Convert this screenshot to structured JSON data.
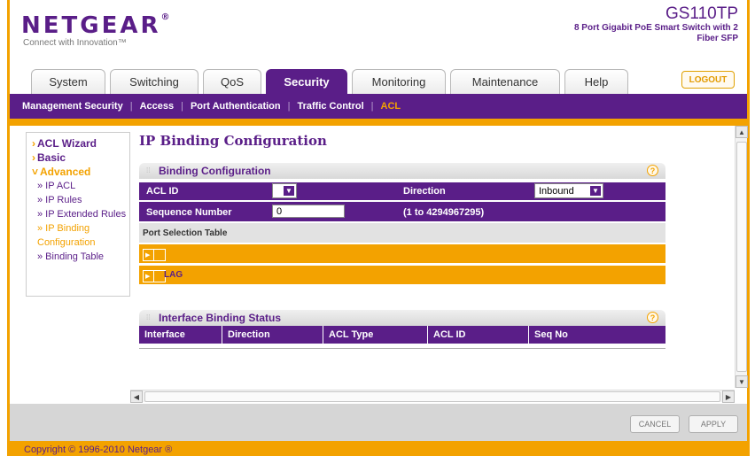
{
  "header": {
    "logo": "NETGEAR",
    "logo_mark": "®",
    "tagline": "Connect with Innovation™",
    "model_name": "GS110TP",
    "model_desc": "8 Port Gigabit PoE Smart Switch with 2 Fiber SFP"
  },
  "tabs": [
    {
      "label": "System",
      "active": false
    },
    {
      "label": "Switching",
      "active": false
    },
    {
      "label": "QoS",
      "active": false
    },
    {
      "label": "Security",
      "active": true
    },
    {
      "label": "Monitoring",
      "active": false
    },
    {
      "label": "Maintenance",
      "active": false
    },
    {
      "label": "Help",
      "active": false
    }
  ],
  "logout_label": "LOGOUT",
  "submenu": [
    {
      "label": "Management Security",
      "active": false
    },
    {
      "label": "Access",
      "active": false
    },
    {
      "label": "Port Authentication",
      "active": false
    },
    {
      "label": "Traffic Control",
      "active": false
    },
    {
      "label": "ACL",
      "active": true
    }
  ],
  "leftnav": {
    "acl_wizard": "ACL Wizard",
    "basic": "Basic",
    "advanced": "Advanced",
    "ip_acl": "» IP ACL",
    "ip_rules": "» IP Rules",
    "ip_extended_rules": "» IP Extended Rules",
    "ip_binding_configuration": "» IP Binding Configuration",
    "binding_table": "» Binding Table"
  },
  "page_title": "IP Binding Configuration",
  "binding_config": {
    "section_title": "Binding Configuration",
    "acl_id_label": "ACL ID",
    "acl_id_value": "",
    "direction_label": "Direction",
    "direction_value": "Inbound",
    "seq_label": "Sequence Number",
    "seq_value": "0",
    "seq_range": "(1 to 4294967295)",
    "port_table_label": "Port Selection Table",
    "row1_label": "",
    "row2_label": "LAG"
  },
  "status": {
    "section_title": "Interface Binding Status",
    "columns": [
      "Interface",
      "Direction",
      "ACL Type",
      "ACL ID",
      "Seq No"
    ]
  },
  "buttons": {
    "cancel": "CANCEL",
    "apply": "APPLY"
  },
  "copyright": "Copyright © 1996-2010 Netgear ®",
  "colors": {
    "brand_purple": "#5a1e88",
    "accent_orange": "#f3a200"
  }
}
